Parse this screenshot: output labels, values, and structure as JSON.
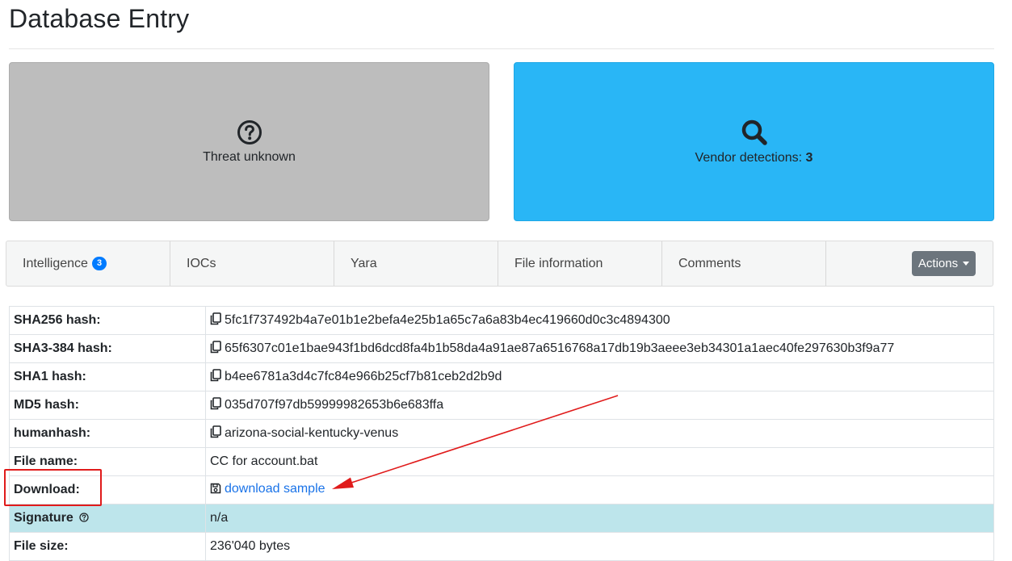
{
  "page": {
    "title": "Database Entry"
  },
  "cards": {
    "threat": {
      "label": "Threat unknown",
      "icon": "question-circle-icon",
      "color": "#bdbdbd"
    },
    "vendor": {
      "label_prefix": "Vendor detections: ",
      "count": "3",
      "icon": "search-icon",
      "color": "#29b6f6"
    }
  },
  "tabs": {
    "intelligence": {
      "label": "Intelligence",
      "badge": "3"
    },
    "iocs": {
      "label": "IOCs"
    },
    "yara": {
      "label": "Yara"
    },
    "file_information": {
      "label": "File information"
    },
    "comments": {
      "label": "Comments"
    },
    "actions": {
      "label": "Actions"
    }
  },
  "details": {
    "sha256": {
      "key": "SHA256 hash:",
      "value": "5fc1f737492b4a7e01b1e2befa4e25b1a65c7a6a83b4ec419660d0c3c4894300"
    },
    "sha3_384": {
      "key": "SHA3-384 hash:",
      "value": "65f6307c01e1bae943f1bd6dcd8fa4b1b58da4a91ae87a6516768a17db19b3aeee3eb34301a1aec40fe297630b3f9a77"
    },
    "sha1": {
      "key": "SHA1 hash:",
      "value": "b4ee6781a3d4c7fc84e966b25cf7b81ceb2d2b9d"
    },
    "md5": {
      "key": "MD5 hash:",
      "value": "035d707f97db59999982653b6e683ffa"
    },
    "humanhash": {
      "key": "humanhash:",
      "value": "arizona-social-kentucky-venus"
    },
    "file_name": {
      "key": "File name:",
      "value": "CC for account.bat"
    },
    "download": {
      "key": "Download:",
      "value": "download sample"
    },
    "signature": {
      "key": "Signature",
      "value": "n/a"
    },
    "file_size": {
      "key": "File size:",
      "value": "236'040 bytes"
    }
  },
  "annotation": {
    "color": "#e01b1b"
  }
}
